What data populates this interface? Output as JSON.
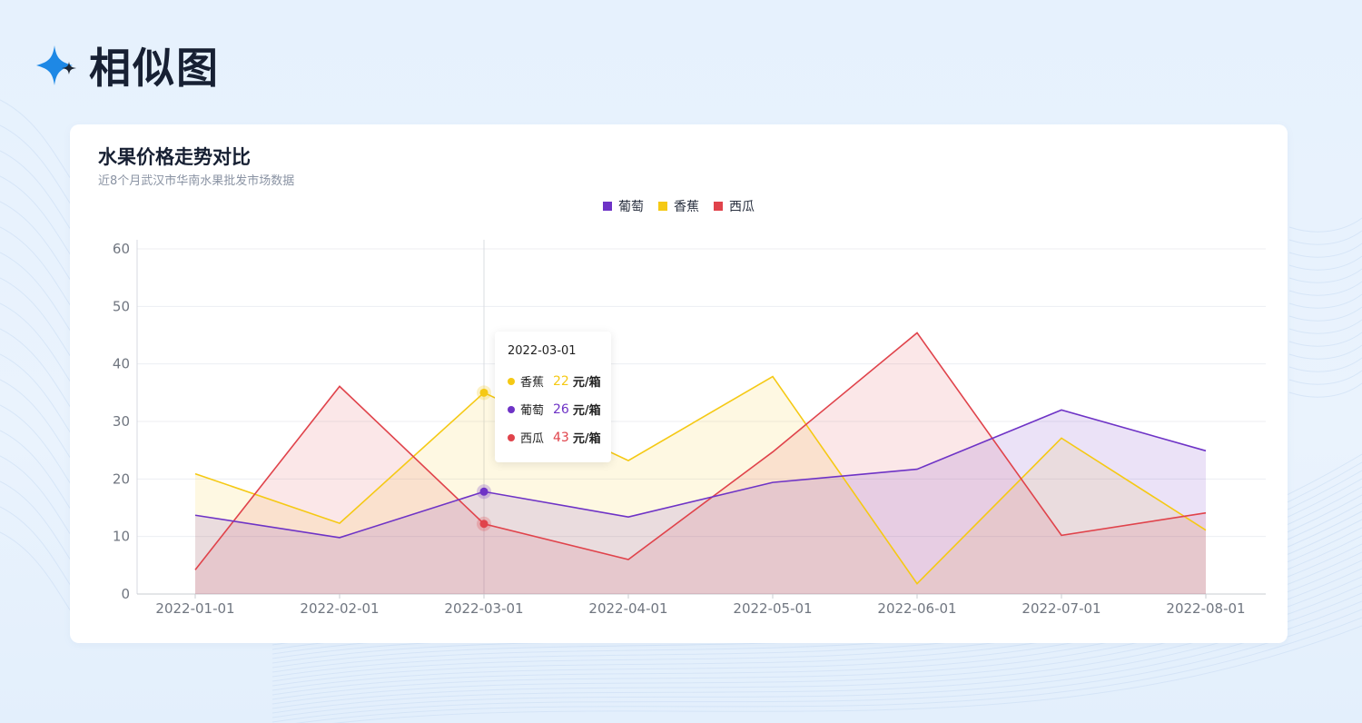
{
  "page": {
    "title": "相似图"
  },
  "colors": {
    "grape": "#6e33c6",
    "banana": "#f5c914",
    "watermelon": "#e0434b",
    "accent_star": "#1e88e5"
  },
  "icons": {
    "logo": "four-point-star-icon"
  },
  "chart_data": {
    "type": "area",
    "title": "水果价格走势对比",
    "subtitle": "近8个月武汉市华南水果批发市场数据",
    "x": [
      "2022-01-01",
      "2022-02-01",
      "2022-03-01",
      "2022-04-01",
      "2022-05-01",
      "2022-06-01",
      "2022-07-01",
      "2022-08-01"
    ],
    "ylim": [
      0,
      60
    ],
    "yticks": [
      0,
      10,
      20,
      30,
      40,
      50,
      60
    ],
    "grid": true,
    "legend_position": "top-center",
    "series": [
      {
        "name": "葡萄",
        "color": "#6e33c6",
        "values": [
          13.7,
          9.8,
          17.8,
          13.4,
          19.4,
          21.7,
          32,
          24.9
        ]
      },
      {
        "name": "香蕉",
        "color": "#f5c914",
        "values": [
          20.9,
          12.3,
          35,
          23.2,
          37.8,
          1.8,
          27.1,
          11.1
        ]
      },
      {
        "name": "西瓜",
        "color": "#e0434b",
        "values": [
          4.2,
          36.1,
          12.2,
          6,
          24.7,
          45.4,
          10.2,
          14.1
        ]
      }
    ],
    "highlight_index": 2
  },
  "tooltip": {
    "date": "2022-03-01",
    "unit": "元/箱",
    "rows": [
      {
        "name": "香蕉",
        "value": "22",
        "color": "#f5c914"
      },
      {
        "name": "葡萄",
        "value": "26",
        "color": "#6e33c6"
      },
      {
        "name": "西瓜",
        "value": "43",
        "color": "#e0434b"
      }
    ]
  }
}
